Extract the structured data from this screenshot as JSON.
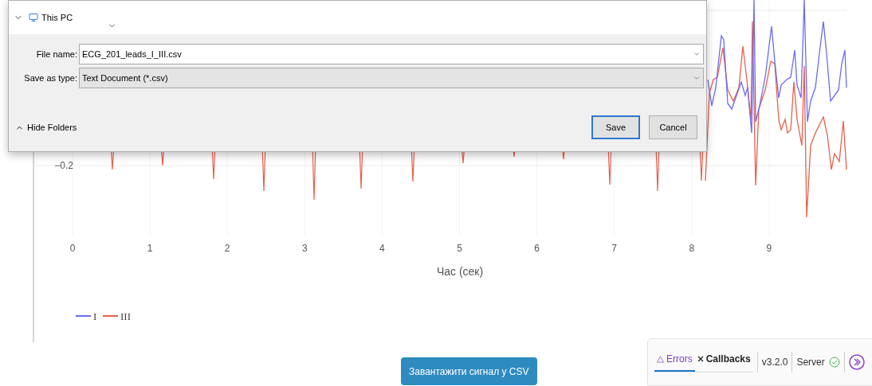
{
  "file_dialog": {
    "tree_item": "This PC",
    "fields": [
      {
        "label": "File name:",
        "value": "ECG_201_leads_I_III.csv",
        "kind": "input"
      },
      {
        "label": "Save as type:",
        "value": "Text Document (*.csv)",
        "kind": "select"
      }
    ],
    "hide_folders": "Hide Folders",
    "buttons": [
      {
        "label": "Save",
        "default": true
      },
      {
        "label": "Cancel",
        "default": false
      }
    ]
  },
  "chart": {
    "ytick": "−0.2",
    "xticks": [
      "0",
      "1",
      "2",
      "3",
      "4",
      "5",
      "6",
      "7",
      "8",
      "9"
    ],
    "xlabel": "Час (сек)",
    "legend": [
      {
        "name": "I",
        "color": "#6b6bf0"
      },
      {
        "name": "III",
        "color": "#e8604c"
      }
    ]
  },
  "download_button": "Завантажити сигнал у CSV",
  "debug_bar": {
    "tabs": [
      {
        "label": "Errors",
        "selected": true
      },
      {
        "label": "Callbacks",
        "selected": false
      }
    ],
    "version": "v3.2.0",
    "server": "Server"
  }
}
